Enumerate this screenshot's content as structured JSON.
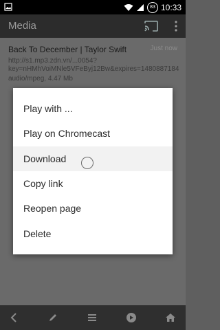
{
  "status": {
    "time": "10:33",
    "battery": "83"
  },
  "appbar": {
    "title": "Media",
    "cast_icon": "cast-icon",
    "more_icon": "more-vert-icon"
  },
  "item": {
    "title": "Back To December | Taylor Swift",
    "time": "Just now",
    "url": "http://s1.mp3.zdn.vn/...0054?key=nHMhVoiMNle5VFeByj12Bw&expires=1480887184",
    "meta": "audio/mpeg, 4.47 Mb"
  },
  "menu": {
    "items": [
      "Play with ...",
      "Play on Chromecast",
      "Download",
      "Copy link",
      "Reopen page",
      "Delete"
    ]
  },
  "bottom": [
    "back-icon",
    "edit-icon",
    "menu-icon",
    "play-icon",
    "home-icon"
  ],
  "colors": {
    "appbar": "#2c2c2c",
    "scrim": "#5f5f5f",
    "menu": "#ffffff",
    "bottombar": "#2f2f2f"
  }
}
